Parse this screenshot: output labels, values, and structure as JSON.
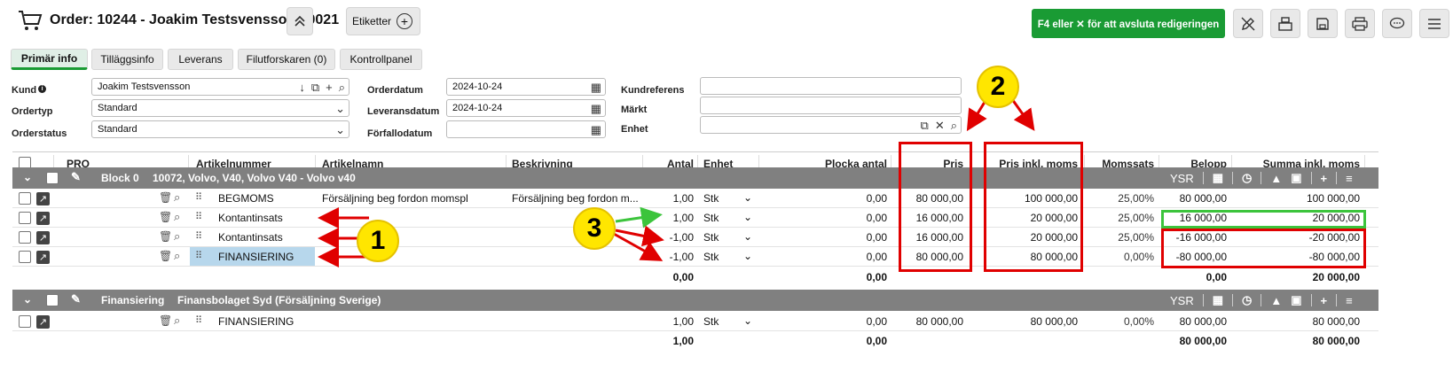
{
  "header": {
    "title": "Order: 10244 - Joakim Testsvensson 10021",
    "etiketter_label": "Etiketter",
    "finish_button": "F4 eller ✕ för att avsluta redigeringen"
  },
  "tabs": [
    {
      "label": "Primär info"
    },
    {
      "label": "Tilläggsinfo"
    },
    {
      "label": "Leverans"
    },
    {
      "label": "Filutforskaren (0)"
    },
    {
      "label": "Kontrollpanel"
    }
  ],
  "form": {
    "kund_label": "Kund",
    "kund_value": "Joakim Testsvensson",
    "ordertyp_label": "Ordertyp",
    "ordertyp_value": "Standard",
    "orderstatus_label": "Orderstatus",
    "orderstatus_value": "Standard",
    "orderdatum_label": "Orderdatum",
    "orderdatum_value": "2024-10-24",
    "leveransdatum_label": "Leveransdatum",
    "leveransdatum_value": "2024-10-24",
    "forfallodatum_label": "Förfallodatum",
    "forfallodatum_value": "",
    "kundreferens_label": "Kundreferens",
    "markt_label": "Märkt",
    "enhet_label": "Enhet"
  },
  "columns": {
    "pro": "PRO",
    "artikelnummer": "Artikelnummer",
    "artikelnamn": "Artikelnamn",
    "beskrivning": "Beskrivning",
    "antal": "Antal",
    "enhet": "Enhet",
    "plocka": "Plocka antal",
    "pris": "Pris",
    "pris_inkl": "Pris inkl. moms",
    "momssats": "Momssats",
    "belopp": "Belopp",
    "summa": "Summa inkl. moms"
  },
  "block0": {
    "name": "Block 0",
    "desc": "10072, Volvo, V40, Volvo V40 - Volvo v40",
    "ysr": "YSR",
    "rows": [
      {
        "artnr": "BEGMOMS",
        "namn": "Försäljning beg fordon momspl",
        "beskr": "Försäljning beg fordon m...",
        "antal": "1,00",
        "enhet": "Stk",
        "plocka": "0,00",
        "pris": "80 000,00",
        "pris_inkl": "100 000,00",
        "moms": "25,00%",
        "belopp": "80 000,00",
        "summa": "100 000,00"
      },
      {
        "artnr": "Kontantinsats",
        "namn": "",
        "beskr": "",
        "antal": "1,00",
        "enhet": "Stk",
        "plocka": "0,00",
        "pris": "16 000,00",
        "pris_inkl": "20 000,00",
        "moms": "25,00%",
        "belopp": "16 000,00",
        "summa": "20 000,00"
      },
      {
        "artnr": "Kontantinsats",
        "namn": "",
        "beskr": "",
        "antal": "-1,00",
        "enhet": "Stk",
        "plocka": "0,00",
        "pris": "16 000,00",
        "pris_inkl": "20 000,00",
        "moms": "25,00%",
        "belopp": "-16 000,00",
        "summa": "-20 000,00"
      },
      {
        "artnr": "FINANSIERING",
        "namn": "",
        "beskr": "",
        "antal": "-1,00",
        "enhet": "Stk",
        "plocka": "0,00",
        "pris": "80 000,00",
        "pris_inkl": "80 000,00",
        "moms": "0,00%",
        "belopp": "-80 000,00",
        "summa": "-80 000,00"
      }
    ],
    "total_antal": "0,00",
    "total_plocka": "0,00",
    "total_belopp": "0,00",
    "total_summa": "20 000,00"
  },
  "block1": {
    "name": "Finansiering",
    "desc": "Finansbolaget Syd (Försäljning Sverige)",
    "ysr": "YSR",
    "rows": [
      {
        "artnr": "FINANSIERING",
        "namn": "",
        "beskr": "",
        "antal": "1,00",
        "enhet": "Stk",
        "plocka": "0,00",
        "pris": "80 000,00",
        "pris_inkl": "80 000,00",
        "moms": "0,00%",
        "belopp": "80 000,00",
        "summa": "80 000,00"
      }
    ],
    "total_antal": "1,00",
    "total_plocka": "0,00",
    "total_belopp": "80 000,00",
    "total_summa": "80 000,00"
  },
  "callouts": {
    "one": "1",
    "two": "2",
    "three": "3"
  },
  "colors": {
    "accent_green": "#1a9b34",
    "annotation_red": "#e00000",
    "annotation_green": "#3cc43c",
    "callout_yellow": "#ffe600",
    "block_gray": "#808080"
  }
}
